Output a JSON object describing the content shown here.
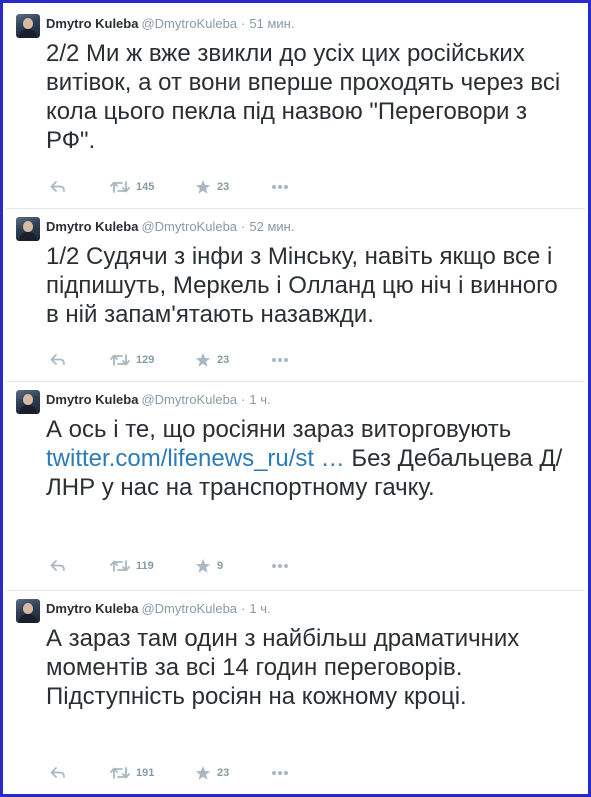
{
  "tweets": [
    {
      "name": "Dmytro Kuleba",
      "handle": "@DmytroKuleba",
      "separator": "·",
      "time": "51 мин.",
      "text_before": "2/2 Ми ж вже звикли до усіх цих російських витівок, а от вони вперше проходять через всі кола цього пекла під назвою \"Переговори з РФ\".",
      "link": "",
      "text_after": "",
      "retweets": "145",
      "favorites": "23"
    },
    {
      "name": "Dmytro Kuleba",
      "handle": "@DmytroKuleba",
      "separator": "·",
      "time": "52 мин.",
      "text_before": "1/2 Судячи з інфи з Мінську, навіть якщо все і підпишуть, Меркель і Олланд цю ніч і винного в ній запам'ятають назавжди.",
      "link": "",
      "text_after": "",
      "retweets": "129",
      "favorites": "23"
    },
    {
      "name": "Dmytro Kuleba",
      "handle": "@DmytroKuleba",
      "separator": "·",
      "time": "1 ч.",
      "text_before": "А ось і те, що росіяни зараз виторговують ",
      "link": "twitter.com/lifenews_ru/st …",
      "text_after": " Без Дебальцева Д/ЛНР у нас на транспортному гачку.",
      "retweets": "119",
      "favorites": "9"
    },
    {
      "name": "Dmytro Kuleba",
      "handle": "@DmytroKuleba",
      "separator": "·",
      "time": "1 ч.",
      "text_before": "А зараз там один з найбільш драматичних моментів за всі 14 годин переговорів. Підступність росіян на кожному кроці.",
      "link": "",
      "text_after": "",
      "retweets": "191",
      "favorites": "23"
    }
  ],
  "icons": {
    "reply": "reply-icon",
    "retweet": "retweet-icon",
    "favorite": "star-icon",
    "more": "more-icon"
  },
  "colors": {
    "frame_border": "#2a2ac8",
    "text": "#292f33",
    "meta": "#8899a6",
    "link": "#2b7bb9",
    "divider": "#e1e8ed"
  }
}
